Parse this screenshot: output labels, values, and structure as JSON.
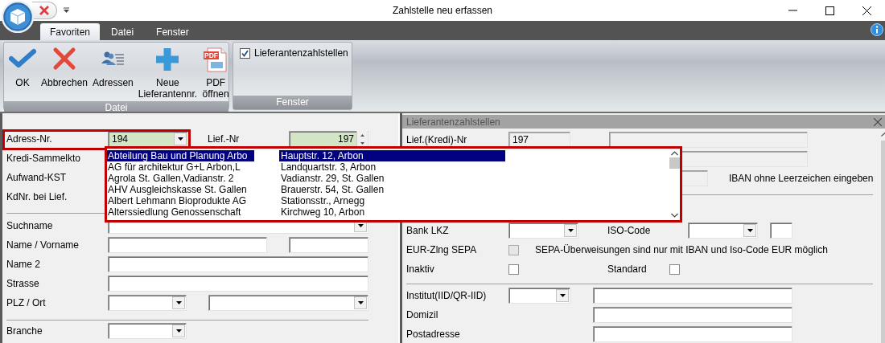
{
  "window": {
    "title": "Zahlstelle neu erfassen"
  },
  "tabs": [
    {
      "label": "Favoriten",
      "selected": true
    },
    {
      "label": "Datei",
      "selected": false
    },
    {
      "label": "Fenster",
      "selected": false
    }
  ],
  "ribbon": {
    "groups": [
      {
        "title": "Datei",
        "buttons": [
          {
            "kind": "check",
            "label": "OK"
          },
          {
            "kind": "cross",
            "label": "Abbrechen"
          },
          {
            "kind": "contacts",
            "label": "Adressen"
          },
          {
            "kind": "plus",
            "label": "Neue\nLieferantennr."
          },
          {
            "kind": "pdf",
            "label": "PDF\nöffnen",
            "badge": "PDF"
          }
        ]
      },
      {
        "title": "Fenster",
        "checkboxes": [
          {
            "label": "Lieferantenzahlstellen",
            "checked": true
          }
        ]
      }
    ]
  },
  "left_panel": {
    "sections": [
      {
        "rows": [
          {
            "label": "Adress-Nr.",
            "fields": [
              {
                "kind": "combo",
                "value": "194",
                "required": true,
                "disabled": false
              },
              {
                "kind": "label",
                "text": "Lief.-Nr"
              },
              {
                "kind": "spin",
                "value": "197",
                "required": true,
                "disabled": false
              }
            ]
          },
          {
            "label": "Kredi-Sammelkto"
          },
          {
            "label": "Aufwand-KST"
          },
          {
            "label": "KdNr. bei Lief."
          }
        ]
      },
      {
        "rows": [
          {
            "label": "Suchname",
            "fields": [
              {
                "kind": "combo",
                "required": false,
                "disabled": false
              }
            ]
          },
          {
            "label": "Name / Vorname",
            "fields": [
              {
                "kind": "text",
                "required": false,
                "disabled": false
              },
              {
                "kind": "text",
                "required": false,
                "disabled": false
              }
            ]
          },
          {
            "label": "Name 2",
            "fields": [
              {
                "kind": "text",
                "required": false,
                "disabled": false
              }
            ]
          },
          {
            "label": "Strasse",
            "fields": [
              {
                "kind": "text",
                "required": false,
                "disabled": false
              }
            ]
          },
          {
            "label": "PLZ / Ort",
            "fields": [
              {
                "kind": "combo",
                "required": false,
                "disabled": false
              },
              {
                "kind": "combo",
                "required": false,
                "disabled": false
              }
            ]
          }
        ]
      },
      {
        "rows": [
          {
            "label": "Branche",
            "fields": [
              {
                "kind": "combo",
                "required": false,
                "disabled": false
              }
            ]
          }
        ]
      }
    ]
  },
  "right_panel": {
    "title": "Lieferantenzahlstellen",
    "sections": [
      {
        "rows": [
          {
            "label": "Lief.(Kredi)-Nr",
            "fields": [
              {
                "kind": "text",
                "value": "197",
                "disabled": true
              },
              {
                "kind": "text",
                "disabled": true
              }
            ]
          },
          {
            "fields": [
              {
                "kind": "text",
                "disabled": true
              }
            ]
          },
          {
            "fields": [
              {
                "kind": "text",
                "disabled": true
              },
              {
                "kind": "note",
                "text": "IBAN ohne Leerzeichen eingeben"
              }
            ]
          }
        ]
      },
      {
        "rows": [
          {
            "label": "Bank LKZ",
            "fields": [
              {
                "kind": "combo",
                "disabled": false
              },
              {
                "kind": "label",
                "text": "ISO-Code"
              },
              {
                "kind": "combo",
                "disabled": false
              },
              {
                "kind": "text",
                "disabled": false
              }
            ]
          },
          {
            "label": "EUR-Zlng SEPA",
            "fields": [
              {
                "kind": "check",
                "checked": false,
                "disabled": true
              },
              {
                "kind": "note",
                "text": "SEPA-Überweisungen sind nur mit IBAN und Iso-Code EUR möglich"
              }
            ]
          },
          {
            "label": "Inaktiv",
            "fields": [
              {
                "kind": "check",
                "checked": false,
                "disabled": false
              },
              {
                "kind": "label",
                "text": "Standard"
              },
              {
                "kind": "check",
                "checked": false,
                "disabled": false
              }
            ]
          }
        ]
      },
      {
        "rows": [
          {
            "label": "Institut(IID/QR-IID)",
            "fields": [
              {
                "kind": "combo",
                "disabled": false
              },
              {
                "kind": "text",
                "disabled": false
              }
            ]
          },
          {
            "label": "Domizil",
            "fields": [
              {
                "kind": "text",
                "disabled": false
              }
            ]
          },
          {
            "label": "Postadresse",
            "fields": [
              {
                "kind": "text",
                "disabled": false
              }
            ]
          }
        ]
      }
    ]
  },
  "dropdown": {
    "items": [
      {
        "name": "Abteilung Bau und Planung Arbo",
        "address": "Hauptstr. 12, Arbon",
        "selected": true
      },
      {
        "name": "AG für architektur G+L Arbon,L",
        "address": "Landquartstr. 3, Arbon",
        "selected": false
      },
      {
        "name": "Agrola St. Gallen,Vadianstr. 2",
        "address": "Vadianstr. 29, St. Gallen",
        "selected": false
      },
      {
        "name": "AHV Ausgleichskasse St. Gallen",
        "address": "Brauerstr. 54, St. Gallen",
        "selected": false
      },
      {
        "name": "Albert Lehmann Bioprodukte AG",
        "address": "Stationsstr., Arnegg",
        "selected": false
      },
      {
        "name": "Alterssiedlung Genossenschaft",
        "address": "Kirchweg 10, Arbon",
        "selected": false
      }
    ]
  }
}
